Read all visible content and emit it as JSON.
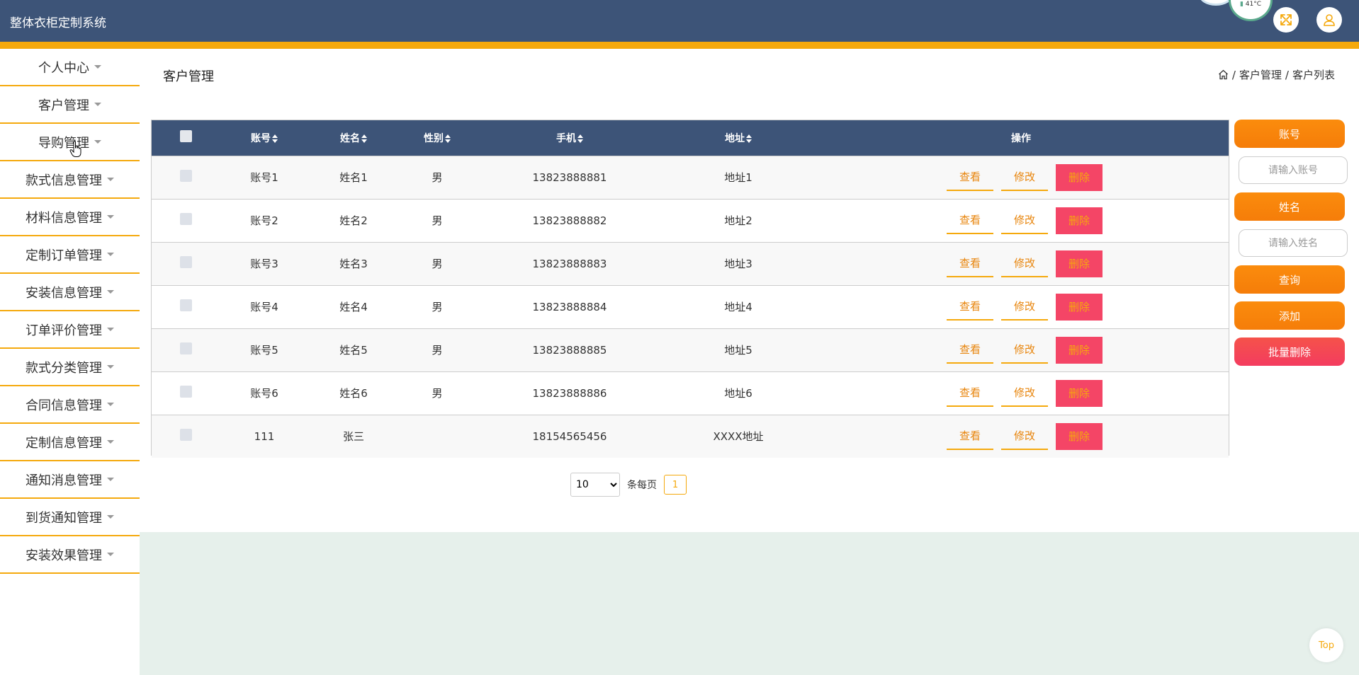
{
  "app": {
    "title": "整体衣柜定制系统"
  },
  "weather": {
    "temp": "41°C"
  },
  "sidebar": {
    "items": [
      {
        "label": "个人中心"
      },
      {
        "label": "客户管理"
      },
      {
        "label": "导购管理"
      },
      {
        "label": "款式信息管理"
      },
      {
        "label": "材料信息管理"
      },
      {
        "label": "定制订单管理"
      },
      {
        "label": "安装信息管理"
      },
      {
        "label": "订单评价管理"
      },
      {
        "label": "款式分类管理"
      },
      {
        "label": "合同信息管理"
      },
      {
        "label": "定制信息管理"
      },
      {
        "label": "通知消息管理"
      },
      {
        "label": "到货通知管理"
      },
      {
        "label": "安装效果管理"
      }
    ]
  },
  "page": {
    "title": "客户管理",
    "breadcrumb": {
      "level1": "客户管理",
      "level2": "客户列表"
    }
  },
  "table": {
    "headers": {
      "account": "账号",
      "name": "姓名",
      "gender": "性别",
      "phone": "手机",
      "address": "地址",
      "actions": "操作"
    },
    "rows": [
      {
        "account": "账号1",
        "name": "姓名1",
        "gender": "男",
        "phone": "13823888881",
        "address": "地址1"
      },
      {
        "account": "账号2",
        "name": "姓名2",
        "gender": "男",
        "phone": "13823888882",
        "address": "地址2"
      },
      {
        "account": "账号3",
        "name": "姓名3",
        "gender": "男",
        "phone": "13823888883",
        "address": "地址3"
      },
      {
        "account": "账号4",
        "name": "姓名4",
        "gender": "男",
        "phone": "13823888884",
        "address": "地址4"
      },
      {
        "account": "账号5",
        "name": "姓名5",
        "gender": "男",
        "phone": "13823888885",
        "address": "地址5"
      },
      {
        "account": "账号6",
        "name": "姓名6",
        "gender": "男",
        "phone": "13823888886",
        "address": "地址6"
      },
      {
        "account": "111",
        "name": "张三",
        "gender": "",
        "phone": "18154565456",
        "address": "XXXX地址"
      }
    ],
    "row_actions": {
      "view": "查看",
      "edit": "修改",
      "delete": "删除"
    }
  },
  "pagination": {
    "page_size": "10",
    "per_page_label": "条每页",
    "current_page": "1"
  },
  "search_panel": {
    "account_label": "账号",
    "account_placeholder": "请输入账号",
    "name_label": "姓名",
    "name_placeholder": "请输入姓名",
    "query_button": "查询",
    "add_button": "添加",
    "batch_delete_button": "批量删除"
  },
  "back_to_top": "Top",
  "colors": {
    "header_bg": "#3d5478",
    "accent_yellow": "#f5a90d",
    "orange": "#fb8c0d",
    "red": "#f44566",
    "footer_bg": "#e6f0eb"
  }
}
